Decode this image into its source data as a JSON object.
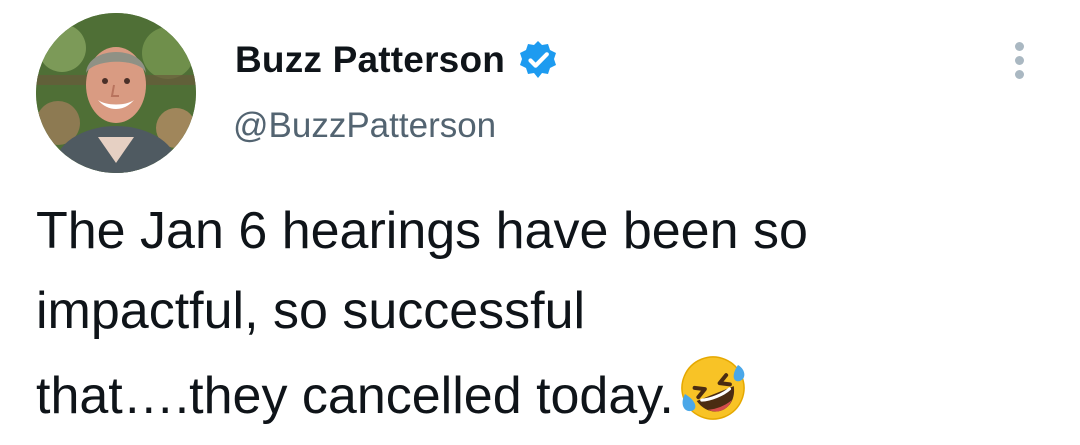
{
  "author": {
    "name": "Buzz Patterson",
    "handle": "@BuzzPatterson",
    "verified_color": "#1d9bf0"
  },
  "tweet": {
    "lines": [
      "The Jan 6 hearings have been so",
      "impactful, so successful",
      "that….they cancelled today."
    ],
    "emoji": "rolling-on-the-floor-laughing"
  },
  "icons": {
    "verified": "verified-badge-icon",
    "more": "more-options-icon",
    "emoji": "rolling-laughing-emoji-icon"
  },
  "colors": {
    "text": "#0f1419",
    "secondary_text": "#536471",
    "accent": "#1d9bf0"
  }
}
